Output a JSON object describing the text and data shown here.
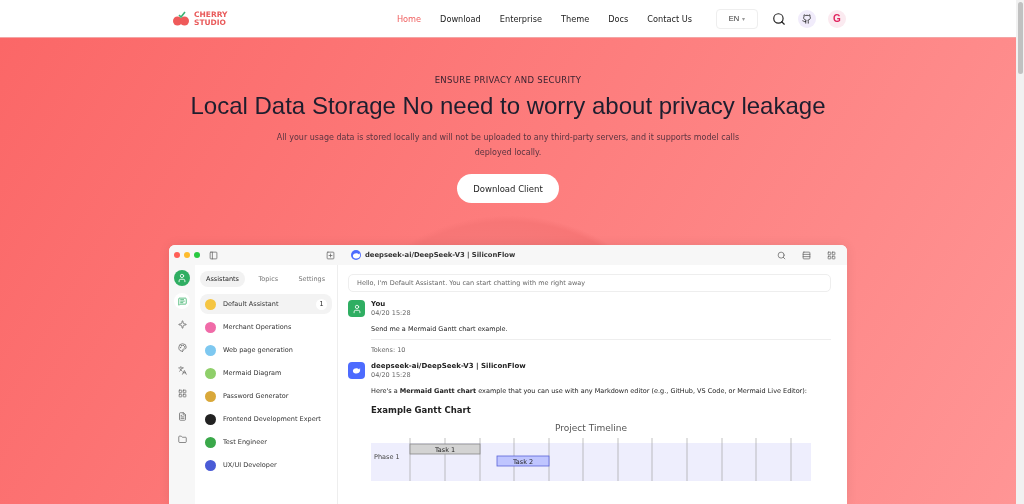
{
  "nav": {
    "logo": "CHERRY STUDIO",
    "links": [
      {
        "label": "Home",
        "selected": true
      },
      {
        "label": "Download",
        "selected": false
      },
      {
        "label": "Enterprise",
        "selected": false
      },
      {
        "label": "Theme",
        "selected": false
      },
      {
        "label": "Docs",
        "selected": false
      },
      {
        "label": "Contact Us",
        "selected": false
      }
    ],
    "language": "EN",
    "language_caret": "▾",
    "profile_badge": "G"
  },
  "hero": {
    "kicker": "ENSURE PRIVACY AND SECURITY",
    "title": "Local Data Storage No need to worry about privacy leakage",
    "text": "All your usage data is stored locally and will not be uploaded to any third-party servers, and it supports model calls deployed locally.",
    "button": "Download Client"
  },
  "app": {
    "rail": [
      {
        "kind": "chat",
        "selected": true
      },
      {
        "kind": "sparkle",
        "selected": false
      },
      {
        "kind": "palette",
        "selected": false
      },
      {
        "kind": "translate",
        "selected": false
      },
      {
        "kind": "apps",
        "selected": false
      },
      {
        "kind": "file",
        "selected": false
      },
      {
        "kind": "folder",
        "selected": false
      }
    ],
    "tabs": [
      {
        "label": "Assistants",
        "selected": true
      },
      {
        "label": "Topics",
        "selected": false
      },
      {
        "label": "Settings",
        "selected": false
      }
    ],
    "assistants": [
      {
        "name": "Default Assistant",
        "color": "#f5c542",
        "badge": "1",
        "selected": true
      },
      {
        "name": "Merchant Operations",
        "color": "#f06ba8",
        "selected": false
      },
      {
        "name": "Web page generation",
        "color": "#7ec8f0",
        "selected": false
      },
      {
        "name": "Mermaid Diagram",
        "color": "#8fcf6a",
        "selected": false
      },
      {
        "name": "Password Generator",
        "color": "#d9a83a",
        "selected": false
      },
      {
        "name": "Frontend Development Expert",
        "color": "#222222",
        "selected": false
      },
      {
        "name": "Test Engineer",
        "color": "#3aa84a",
        "selected": false
      },
      {
        "name": "UX/UI Developer",
        "color": "#4a5bd6",
        "selected": false
      }
    ],
    "chat_title": "deepseek-ai/DeepSeek-V3 | SiliconFlow",
    "greeting": "Hello, I'm Default Assistant. You can start chatting with me right away",
    "messages": [
      {
        "kind": "user",
        "author": "You",
        "time": "04/20 15:28",
        "text": "Send me a Mermaid Gantt chart example.",
        "tokens": "Tokens: 10"
      },
      {
        "kind": "model",
        "author": "deepseek-ai/DeepSeek-V3 | SiliconFlow",
        "time": "04/20 15:28",
        "text": "Here's a **Mermaid Gantt chart** example that you can use with any Markdown editor (e.g., GitHub, VS Code, or Mermaid Live Editor):",
        "heading": "Example Gantt Chart"
      }
    ],
    "gantt": {
      "title": "Project Timeline",
      "section": "Phase 1",
      "tasks": [
        {
          "label": "Task 1",
          "kind": "done"
        },
        {
          "label": "Task 2",
          "kind": "active"
        }
      ]
    }
  }
}
